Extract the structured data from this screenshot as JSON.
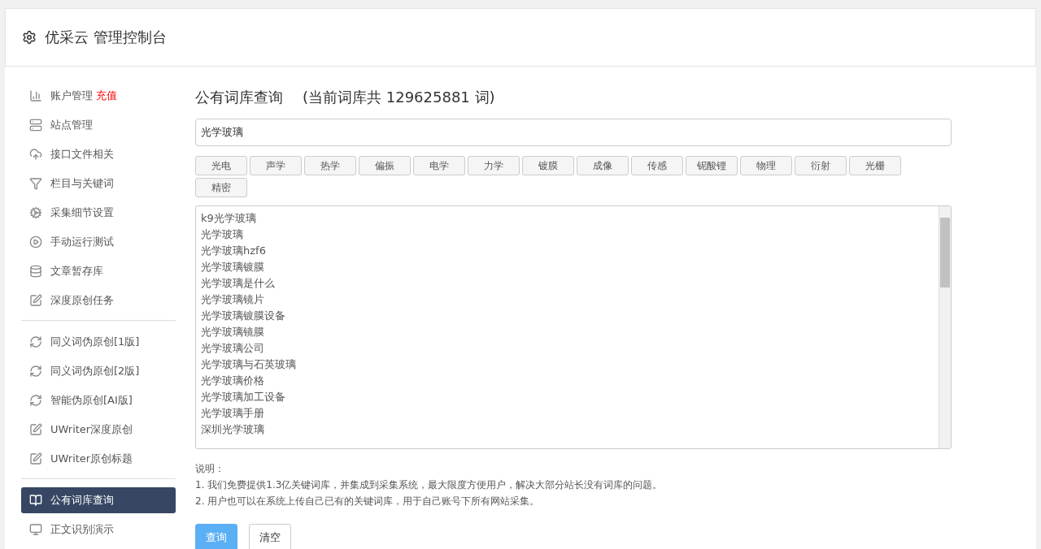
{
  "header": {
    "title": "优采云 管理控制台"
  },
  "sidebar": {
    "groups": [
      {
        "items": [
          {
            "label": "账户管理",
            "badge": "充值",
            "selected": false
          },
          {
            "label": "站点管理",
            "selected": false
          },
          {
            "label": "接口文件相关",
            "selected": false
          },
          {
            "label": "栏目与关键词",
            "selected": false
          },
          {
            "label": "采集细节设置",
            "selected": false
          },
          {
            "label": "手动运行测试",
            "selected": false
          },
          {
            "label": "文章暂存库",
            "selected": false
          },
          {
            "label": "深度原创任务",
            "selected": false
          }
        ]
      },
      {
        "items": [
          {
            "label": "同义词伪原创[1版]",
            "selected": false
          },
          {
            "label": "同义词伪原创[2版]",
            "selected": false
          },
          {
            "label": "智能伪原创[AI版]",
            "selected": false
          },
          {
            "label": "UWriter深度原创",
            "selected": false
          },
          {
            "label": "UWriter原创标题",
            "selected": false
          }
        ]
      },
      {
        "items": [
          {
            "label": "公有词库查询",
            "selected": true
          },
          {
            "label": "正文识别演示",
            "selected": false
          }
        ]
      }
    ]
  },
  "main": {
    "title": "公有词库查询",
    "count_note": "(当前词库共 129625881 词)",
    "search": {
      "value": "光学玻璃"
    },
    "tags": [
      "光电",
      "声学",
      "热学",
      "偏振",
      "电学",
      "力学",
      "镀膜",
      "成像",
      "传感",
      "铌酸锂",
      "物理",
      "衍射",
      "光栅",
      "精密"
    ],
    "results": [
      "k9光学玻璃",
      "光学玻璃",
      "光学玻璃hzf6",
      "光学玻璃镀膜",
      "光学玻璃是什么",
      "光学玻璃镜片",
      "光学玻璃镀膜设备",
      "光学玻璃镜膜",
      "光学玻璃公司",
      "光学玻璃与石英玻璃",
      "光学玻璃价格",
      "光学玻璃加工设备",
      "光学玻璃手册",
      "深圳光学玻璃"
    ],
    "notes_title": "说明：",
    "notes": [
      "1. 我们免费提供1.3亿关键词库，并集成到采集系统，最大限度方便用户，解决大部分站长没有词库的问题。",
      "2. 用户也可以在系统上传自己已有的关键词库，用于自己账号下所有网站采集。"
    ],
    "buttons": [
      {
        "label": "查询",
        "kind": "primary"
      },
      {
        "label": "清空",
        "kind": "default"
      }
    ]
  }
}
